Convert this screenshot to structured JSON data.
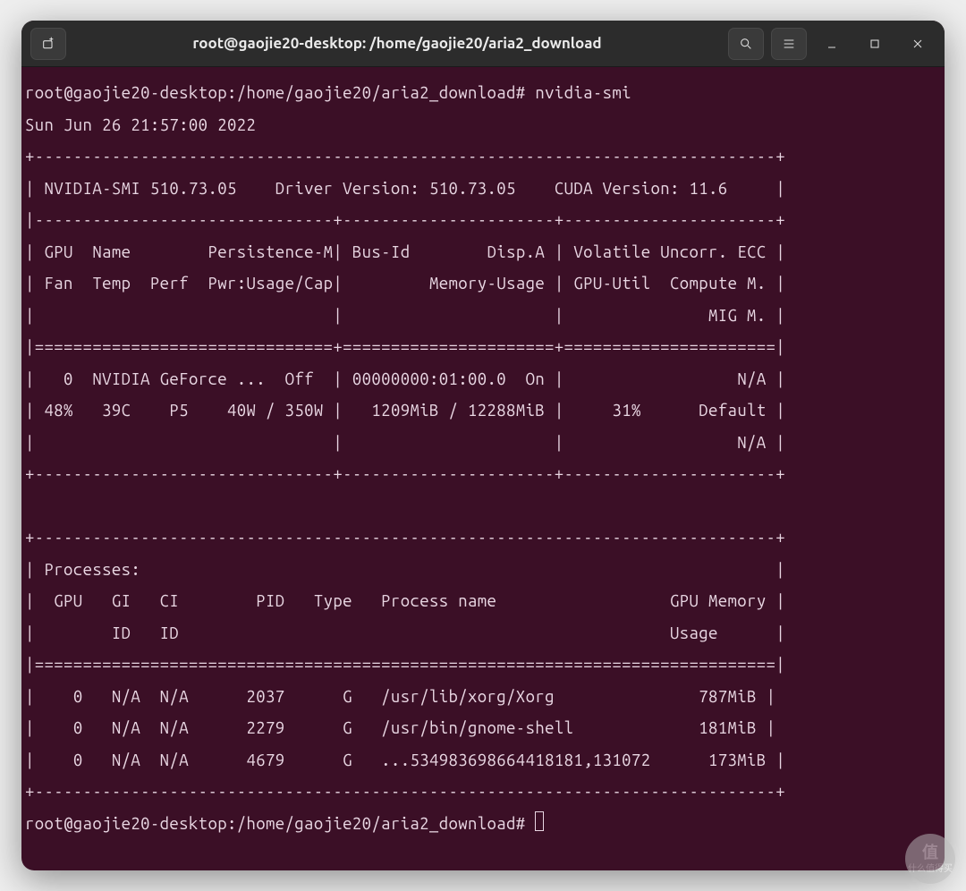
{
  "window": {
    "title": "root@gaojie20-desktop: /home/gaojie20/aria2_download"
  },
  "prompt": {
    "user_host": "root@gaojie20-desktop",
    "path": "/home/gaojie20/aria2_download",
    "sep": ":",
    "hash": "#"
  },
  "command": "nvidia-smi",
  "timestamp": "Sun Jun 26 21:57:00 2022",
  "smi": {
    "header": {
      "smi_version_label": "NVIDIA-SMI",
      "smi_version": "510.73.05",
      "driver_label": "Driver Version:",
      "driver_version": "510.73.05",
      "cuda_label": "CUDA Version:",
      "cuda_version": "11.6"
    },
    "col_headers_row1": {
      "gpu": "GPU",
      "name": "Name",
      "persist": "Persistence-M",
      "busid": "Bus-Id",
      "dispa": "Disp.A",
      "volatile": "Volatile Uncorr. ECC"
    },
    "col_headers_row2": {
      "fan": "Fan",
      "temp": "Temp",
      "perf": "Perf",
      "pwr": "Pwr:Usage/Cap",
      "mem": "Memory-Usage",
      "gpu_util": "GPU-Util",
      "compute": "Compute M."
    },
    "col_headers_row3": {
      "mig": "MIG M."
    },
    "gpu_row": {
      "idx": "0",
      "name": "NVIDIA GeForce ...",
      "persist": "Off",
      "busid": "00000000:01:00.0",
      "disp": "On",
      "ecc": "N/A",
      "fan": "48%",
      "temp": "39C",
      "perf": "P5",
      "pwr": "40W / 350W",
      "mem": "1209MiB / 12288MiB",
      "gpu_util": "31%",
      "compute": "Default",
      "mig": "N/A"
    },
    "processes": {
      "label": "Processes:",
      "headers1": {
        "gpu": "GPU",
        "gi": "GI",
        "ci": "CI",
        "pid": "PID",
        "type": "Type",
        "pname": "Process name",
        "mem": "GPU Memory"
      },
      "headers2": {
        "id1": "ID",
        "id2": "ID",
        "usage": "Usage"
      },
      "rows": [
        {
          "gpu": "0",
          "gi": "N/A",
          "ci": "N/A",
          "pid": "2037",
          "type": "G",
          "name": "/usr/lib/xorg/Xorg",
          "mem": "787MiB"
        },
        {
          "gpu": "0",
          "gi": "N/A",
          "ci": "N/A",
          "pid": "2279",
          "type": "G",
          "name": "/usr/bin/gnome-shell",
          "mem": "181MiB"
        },
        {
          "gpu": "0",
          "gi": "N/A",
          "ci": "N/A",
          "pid": "4679",
          "type": "G",
          "name": "...534983698664418181,131072",
          "mem": "173MiB"
        }
      ]
    }
  },
  "watermark": {
    "line1": "值",
    "line2": "什么值得买"
  }
}
